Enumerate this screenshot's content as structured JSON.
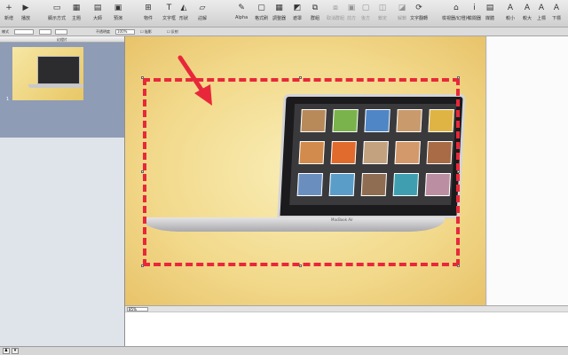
{
  "toolbar": {
    "items": [
      {
        "label": "新增",
        "icon": "plus-icon",
        "glyph": "+"
      },
      {
        "label": "播放",
        "icon": "play-icon",
        "glyph": "▶"
      },
      {
        "label": "顯示方式",
        "icon": "view-icon",
        "glyph": "▭"
      },
      {
        "label": "主題",
        "icon": "theme-icon",
        "glyph": "▦"
      },
      {
        "label": "大師",
        "icon": "masters-icon",
        "glyph": "▤"
      },
      {
        "label": "預演",
        "icon": "rehearse-icon",
        "glyph": "▣"
      },
      {
        "label": "物件",
        "icon": "shapes-icon",
        "glyph": "⊞"
      },
      {
        "label": "文字框",
        "icon": "textbox-icon",
        "glyph": "T"
      },
      {
        "label": "形狀",
        "icon": "shape-icon",
        "glyph": "◭"
      },
      {
        "label": "註解",
        "icon": "comment-icon",
        "glyph": "▱"
      },
      {
        "label": "Alpha",
        "icon": "alpha-icon",
        "glyph": "✎"
      },
      {
        "label": "格式刷",
        "icon": "format-icon",
        "glyph": "▢"
      },
      {
        "label": "調整器",
        "icon": "adjust-icon",
        "glyph": "▦"
      },
      {
        "label": "遮罩",
        "icon": "mask-icon",
        "glyph": "◩"
      },
      {
        "label": "群組",
        "icon": "group-icon",
        "glyph": "⧉"
      },
      {
        "label": "取消群組",
        "icon": "ungroup-icon",
        "glyph": "⧈"
      },
      {
        "label": "前方",
        "icon": "front-icon",
        "glyph": "▣"
      },
      {
        "label": "後方",
        "icon": "back-icon",
        "glyph": "▢"
      },
      {
        "label": "鎖定",
        "icon": "lock-icon",
        "glyph": "◫"
      },
      {
        "label": "解鎖",
        "icon": "unlock-icon",
        "glyph": "◪"
      },
      {
        "label": "文字翻轉",
        "icon": "text-rotate-icon",
        "glyph": "⟳"
      },
      {
        "label": "檢視器/幻燈片",
        "icon": "inspector-icon",
        "glyph": "⌂"
      },
      {
        "label": "檢閱器",
        "icon": "info-icon",
        "glyph": "i"
      },
      {
        "label": "媒體",
        "icon": "media-icon",
        "glyph": "▤"
      },
      {
        "label": "較小",
        "icon": "smaller-icon",
        "glyph": "A"
      },
      {
        "label": "較大",
        "icon": "bigger-icon",
        "glyph": "A"
      },
      {
        "label": "上標",
        "icon": "superscript-icon",
        "glyph": "A"
      },
      {
        "label": "下標",
        "icon": "subscript-icon",
        "glyph": "A"
      }
    ]
  },
  "formatbar": {
    "style_label": "樣式",
    "zoom_value": "100%",
    "opacity_label": "不透明度",
    "check1_label": "陰影",
    "check2_label": "反射"
  },
  "sidebar": {
    "title": "幻燈片",
    "slide_number": "1"
  },
  "slide": {
    "brand": "MacBook Air"
  },
  "notes_bar": {
    "zoom": "85%"
  },
  "colors": {
    "accent": "#e8283a",
    "slide_bg": "#f2d98b"
  }
}
